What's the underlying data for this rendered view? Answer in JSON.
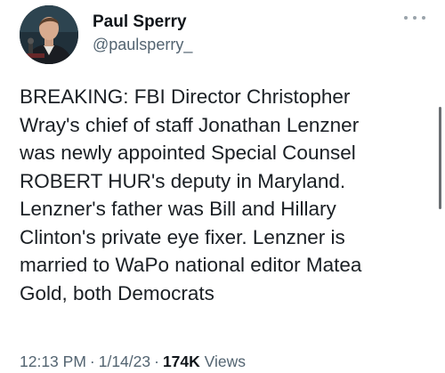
{
  "author": {
    "display_name": "Paul Sperry",
    "handle": "@paulsperry_"
  },
  "tweet": {
    "text": "BREAKING: FBI Director Christopher\nWray's chief of staff Jonathan Lenzner\nwas newly appointed Special Counsel\nROBERT HUR's deputy in Maryland.\nLenzner's father was Bill and Hillary\nClinton's private eye fixer. Lenzner is\nmarried to WaPo national editor Matea\nGold, both Democrats"
  },
  "meta": {
    "time": "12:13 PM",
    "separator": "·",
    "date": "1/14/23",
    "views_count": "174K",
    "views_label": "Views"
  },
  "icons": {
    "more": "more-options-icon",
    "avatar": "profile-photo"
  },
  "colors": {
    "text": "#0f1419",
    "secondary": "#536471",
    "background": "#ffffff"
  }
}
